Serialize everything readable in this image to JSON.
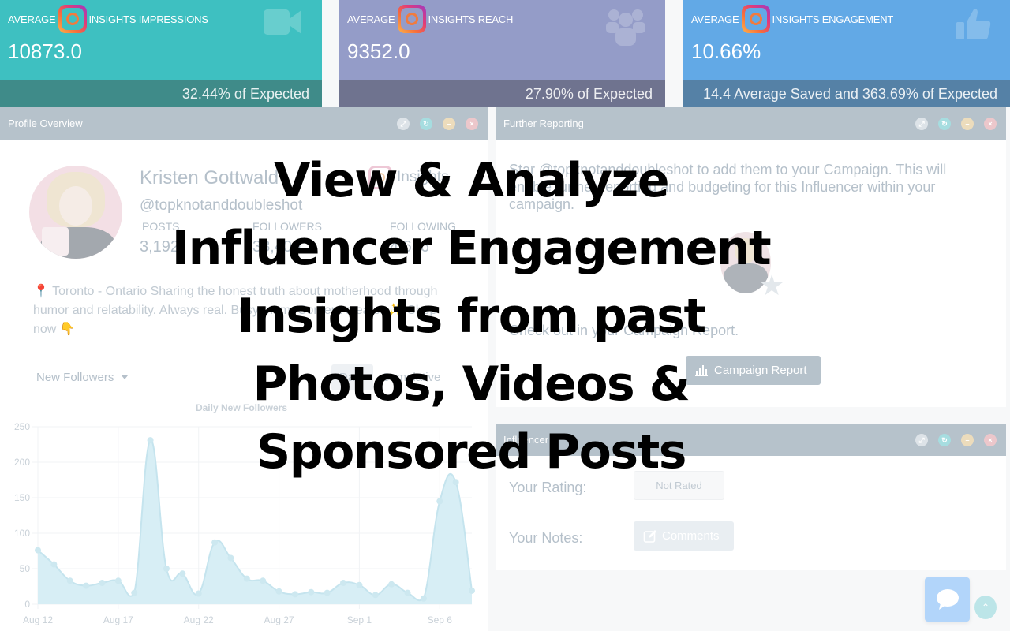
{
  "tiles": [
    {
      "prefix": "AVERAGE",
      "label": "INSIGHTS IMPRESSIONS",
      "value": "10873.0",
      "footer": "32.44% of Expected",
      "icon": "video-camera-icon",
      "color": "#3ec0c1"
    },
    {
      "prefix": "AVERAGE",
      "label": "INSIGHTS REACH",
      "value": "9352.0",
      "footer": "27.90% of Expected",
      "icon": "users-icon",
      "color": "#949cc8"
    },
    {
      "prefix": "AVERAGE",
      "label": "INSIGHTS ENGAGEMENT",
      "value": "10.66%",
      "footer": "14.4 Average Saved and 363.69% of Expected",
      "icon": "thumbs-up-icon",
      "color": "#62a9e6"
    }
  ],
  "profile_panel": {
    "title": "Profile Overview",
    "name": "Kristen Gottwald",
    "insights_label": "Insights",
    "handle": "@topknotanddoubleshot",
    "stats": [
      {
        "label": "POSTS",
        "value": "3,192"
      },
      {
        "label": "FOLLOWERS",
        "value": "38,400"
      },
      {
        "label": "FOLLOWING",
        "value": "4,656"
      }
    ],
    "bio": "📍 Toronto - Ontario Sharing the honest truth about motherhood through humor and relatability. Always real. Busy mom. Content creator ✨  Shop now 👇",
    "metric_select": "New Followers",
    "toggle": {
      "daily": "Daily",
      "cumulative": "Cumulative",
      "active": "daily"
    }
  },
  "further_panel": {
    "title": "Further Reporting",
    "text": "Star @topknotanddoubleshot to add them to your Campaign. This will enable further reporting and budgeting for this Influencer within your campaign.",
    "check_text": "Check out in your Campaign Report.",
    "button_label": "Campaign Report"
  },
  "influencer_panel": {
    "title": "Influencer",
    "rating_label": "Your Rating:",
    "rating_value": "Not Rated",
    "notes_label": "Your Notes:",
    "notes_button": "Comments"
  },
  "panel_controls": [
    "expand",
    "reload",
    "minimize",
    "close"
  ],
  "headline": [
    "View & Analyze",
    "Influencer Engagement",
    "Insights from past",
    "Photos, Videos &",
    "Sponsored Posts"
  ],
  "chart_data": {
    "type": "area",
    "title": "Daily New Followers",
    "xlabel": "",
    "ylabel": "",
    "ylim": [
      0,
      250
    ],
    "yticks": [
      0,
      50,
      100,
      150,
      200,
      250
    ],
    "x": [
      "Aug 12",
      "Aug 13",
      "Aug 14",
      "Aug 15",
      "Aug 16",
      "Aug 17",
      "Aug 18",
      "Aug 19",
      "Aug 20",
      "Aug 21",
      "Aug 22",
      "Aug 23",
      "Aug 24",
      "Aug 25",
      "Aug 26",
      "Aug 27",
      "Aug 28",
      "Aug 29",
      "Aug 30",
      "Aug 31",
      "Sep 1",
      "Sep 2",
      "Sep 3",
      "Sep 4",
      "Sep 5",
      "Sep 6",
      "Sep 7",
      "Sep 8"
    ],
    "xtick_labels": [
      "Aug 12",
      "Aug 17",
      "Aug 22",
      "Aug 27",
      "Sep 1",
      "Sep 6"
    ],
    "series": [
      {
        "name": "New Followers",
        "values": [
          76,
          56,
          33,
          26,
          30,
          33,
          16,
          231,
          50,
          43,
          15,
          87,
          65,
          36,
          33,
          18,
          14,
          17,
          16,
          30,
          27,
          13,
          28,
          16,
          8,
          145,
          172,
          19
        ]
      }
    ],
    "grid": true,
    "legend": "none",
    "fill_color": "#d7eef5",
    "line_color": "#c5e4ee"
  }
}
